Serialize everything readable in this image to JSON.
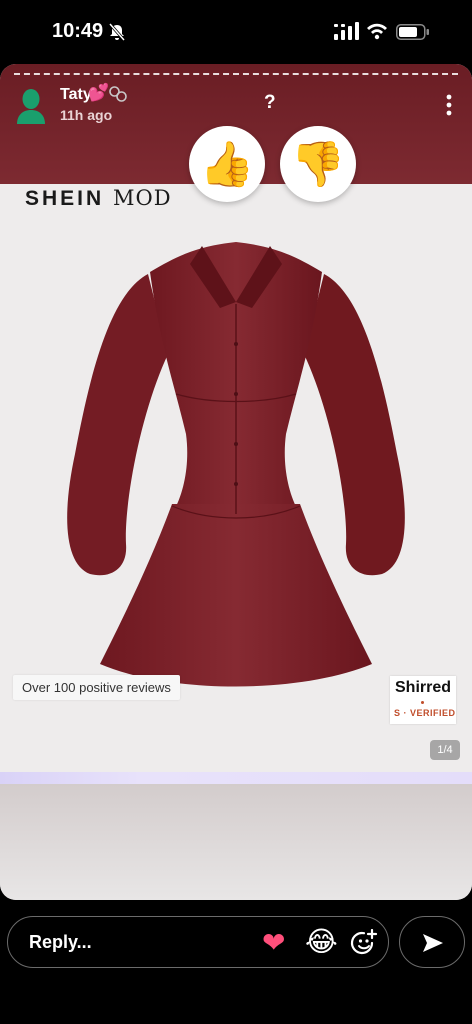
{
  "status_bar": {
    "time": "10:49",
    "silent_icon": "bell-slash-icon",
    "signal_icon": "signal-icon",
    "wifi_icon": "wifi-icon",
    "battery_icon": "battery-icon"
  },
  "story": {
    "username": "Taty",
    "user_emoji": "💕",
    "timestamp": "11h ago",
    "question_mark": "?",
    "vote_up": "👍",
    "vote_down": "👎",
    "colors": {
      "header": "#6a1d24",
      "dress": "#7b1c24"
    }
  },
  "product": {
    "brand_main": "SHEIN",
    "brand_sub": "MOD",
    "review_chip": "Over 100 positive reviews",
    "badge_title": "Shirred",
    "badge_verified": "S · VERIFIED",
    "pager": "1/4"
  },
  "reply": {
    "placeholder": "Reply...",
    "heart": "❤",
    "laugh": "😂",
    "add_emoji_icon": "add-emoji-icon",
    "send_icon": "send-arrow-icon"
  }
}
